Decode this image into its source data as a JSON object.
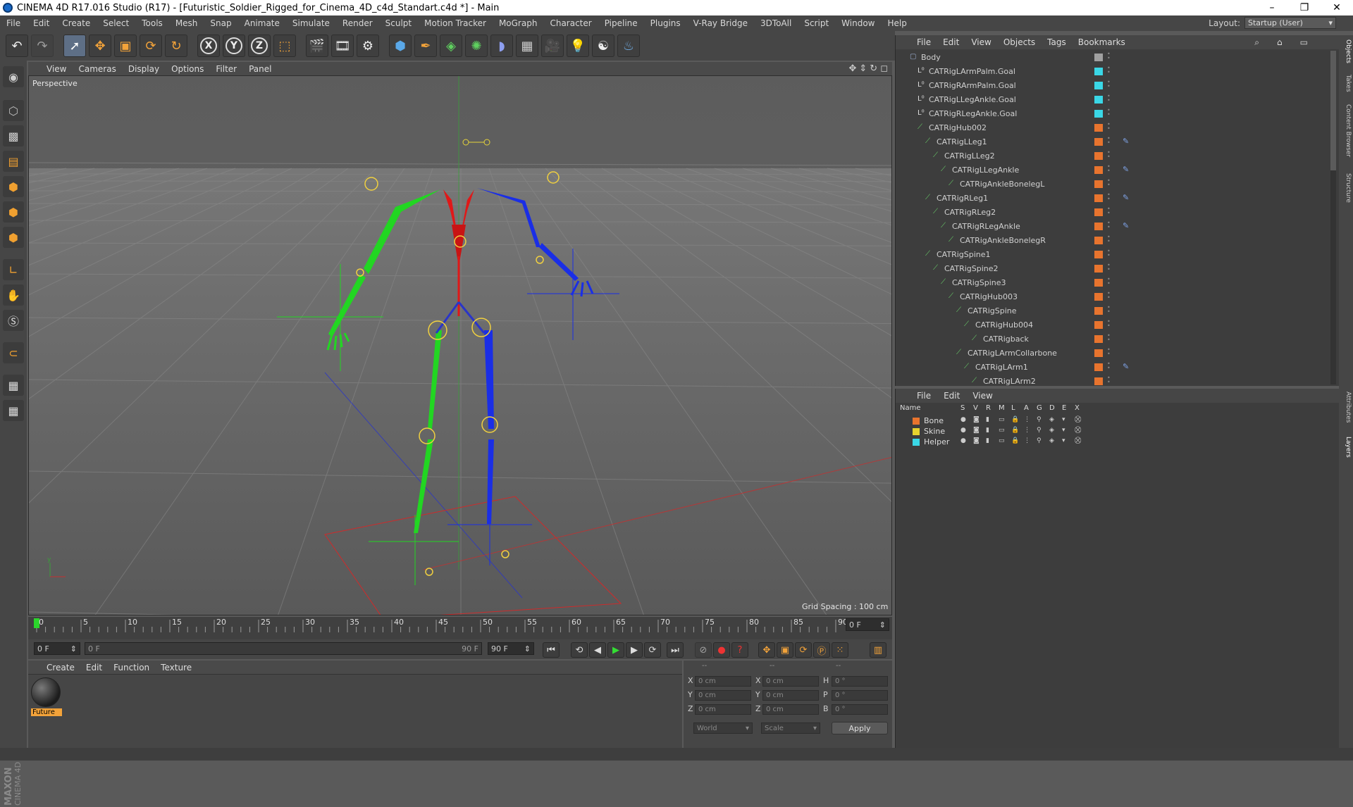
{
  "window": {
    "title": "CINEMA 4D R17.016 Studio (R17) - [Futuristic_Soldier_Rigged_for_Cinema_4D_c4d_Standart.c4d *] - Main",
    "controls": [
      "–",
      "❐",
      "✕"
    ]
  },
  "menubar": {
    "items": [
      "File",
      "Edit",
      "Create",
      "Select",
      "Tools",
      "Mesh",
      "Snap",
      "Animate",
      "Simulate",
      "Render",
      "Sculpt",
      "Motion Tracker",
      "MoGraph",
      "Character",
      "Pipeline",
      "Plugins",
      "V-Ray Bridge",
      "3DToAll",
      "Script",
      "Window",
      "Help"
    ],
    "layout_label": "Layout:",
    "layout_value": "Startup (User)"
  },
  "toolbar": {
    "buttons": [
      "undo-icon",
      "redo-icon",
      "select-icon",
      "move-icon",
      "scale-icon",
      "rotate-icon",
      "recent-tool-icon",
      "x-axis-icon",
      "y-axis-icon",
      "z-axis-icon",
      "coord-system-icon",
      "render-view-icon",
      "render-picture-viewer-icon",
      "edit-render-settings-icon",
      "cube-icon",
      "pen-icon",
      "subdivision-icon",
      "array-icon",
      "deformer-icon",
      "floor-icon",
      "camera-icon",
      "light-icon",
      "cat-icon",
      "python-icon"
    ],
    "axis_labels": [
      "X",
      "Y",
      "Z"
    ]
  },
  "viewport": {
    "menu": [
      "View",
      "Cameras",
      "Display",
      "Options",
      "Filter",
      "Panel"
    ],
    "label": "Perspective",
    "grid_spacing": "Grid Spacing : 100 cm"
  },
  "timeline": {
    "ticks": [
      "0",
      "5",
      "10",
      "15",
      "20",
      "25",
      "30",
      "35",
      "40",
      "45",
      "50",
      "55",
      "60",
      "65",
      "70",
      "75",
      "80",
      "85",
      "90"
    ],
    "current_frame": "0 F",
    "start_field": "0 F",
    "range_start": "0 F",
    "range_end": "90 F",
    "end_field": "90 F"
  },
  "material_manager": {
    "menu": [
      "Create",
      "Edit",
      "Function",
      "Texture"
    ],
    "materials": [
      {
        "name": "Future"
      }
    ]
  },
  "coordinates": {
    "header": [
      "--",
      "--",
      "--"
    ],
    "rows": [
      {
        "a_label": "X",
        "a_val": "0 cm",
        "b_label": "X",
        "b_val": "0 cm",
        "c_label": "H",
        "c_val": "0 °"
      },
      {
        "a_label": "Y",
        "a_val": "0 cm",
        "b_label": "Y",
        "b_val": "0 cm",
        "c_label": "P",
        "c_val": "0 °"
      },
      {
        "a_label": "Z",
        "a_val": "0 cm",
        "b_label": "Z",
        "b_val": "0 cm",
        "c_label": "B",
        "c_val": "0 °"
      }
    ],
    "mode_select": "World",
    "scale_select": "Scale",
    "apply_label": "Apply"
  },
  "object_manager": {
    "menu": [
      "File",
      "Edit",
      "View",
      "Objects",
      "Tags",
      "Bookmarks"
    ],
    "objects": [
      {
        "name": "Body",
        "depth": 0,
        "icon": "null",
        "tag": "#a0a0a0",
        "cat": false
      },
      {
        "name": "CATRigLArmPalm.Goal",
        "depth": 1,
        "icon": "goal",
        "tag": "#3ad7e6",
        "cat": false
      },
      {
        "name": "CATRigRArmPalm.Goal",
        "depth": 1,
        "icon": "goal",
        "tag": "#3ad7e6",
        "cat": false
      },
      {
        "name": "CATRigLLegAnkle.Goal",
        "depth": 1,
        "icon": "goal",
        "tag": "#3ad7e6",
        "cat": false
      },
      {
        "name": "CATRigRLegAnkle.Goal",
        "depth": 1,
        "icon": "goal",
        "tag": "#3ad7e6",
        "cat": false
      },
      {
        "name": "CATRigHub002",
        "depth": 1,
        "icon": "bone",
        "tag": "#e8742e",
        "cat": false
      },
      {
        "name": "CATRigLLeg1",
        "depth": 2,
        "icon": "bone",
        "tag": "#e8742e",
        "cat": true
      },
      {
        "name": "CATRigLLeg2",
        "depth": 3,
        "icon": "bone",
        "tag": "#e8742e",
        "cat": false
      },
      {
        "name": "CATRigLLegAnkle",
        "depth": 4,
        "icon": "bone",
        "tag": "#e8742e",
        "cat": true
      },
      {
        "name": "CATRigAnkleBonelegL",
        "depth": 5,
        "icon": "bone",
        "tag": "#e8742e",
        "cat": false
      },
      {
        "name": "CATRigRLeg1",
        "depth": 2,
        "icon": "bone",
        "tag": "#e8742e",
        "cat": true
      },
      {
        "name": "CATRigRLeg2",
        "depth": 3,
        "icon": "bone",
        "tag": "#e8742e",
        "cat": false
      },
      {
        "name": "CATRigRLegAnkle",
        "depth": 4,
        "icon": "bone",
        "tag": "#e8742e",
        "cat": true
      },
      {
        "name": "CATRigAnkleBonelegR",
        "depth": 5,
        "icon": "bone",
        "tag": "#e8742e",
        "cat": false
      },
      {
        "name": "CATRigSpine1",
        "depth": 2,
        "icon": "bone",
        "tag": "#e8742e",
        "cat": false
      },
      {
        "name": "CATRigSpine2",
        "depth": 3,
        "icon": "bone",
        "tag": "#e8742e",
        "cat": false
      },
      {
        "name": "CATRigSpine3",
        "depth": 4,
        "icon": "bone",
        "tag": "#e8742e",
        "cat": false
      },
      {
        "name": "CATRigHub003",
        "depth": 5,
        "icon": "bone",
        "tag": "#e8742e",
        "cat": false
      },
      {
        "name": "CATRigSpine",
        "depth": 6,
        "icon": "bone",
        "tag": "#e8742e",
        "cat": false
      },
      {
        "name": "CATRigHub004",
        "depth": 7,
        "icon": "bone",
        "tag": "#e8742e",
        "cat": false
      },
      {
        "name": "CATRigback",
        "depth": 8,
        "icon": "bone",
        "tag": "#e8742e",
        "cat": false
      },
      {
        "name": "CATRigLArmCollarbone",
        "depth": 6,
        "icon": "bone",
        "tag": "#e8742e",
        "cat": false
      },
      {
        "name": "CATRigLArm1",
        "depth": 7,
        "icon": "bone",
        "tag": "#e8742e",
        "cat": true
      },
      {
        "name": "CATRigLArm2",
        "depth": 8,
        "icon": "bone",
        "tag": "#e8742e",
        "cat": false
      }
    ]
  },
  "layer_manager": {
    "menu": [
      "File",
      "Edit",
      "View"
    ],
    "columns": [
      "Name",
      "S",
      "V",
      "R",
      "M",
      "L",
      "A",
      "G",
      "D",
      "E",
      "X"
    ],
    "layers": [
      {
        "name": "Bone",
        "color": "#e8742e"
      },
      {
        "name": "Skine",
        "color": "#e6d22e"
      },
      {
        "name": "Helper",
        "color": "#3ad7e6"
      }
    ]
  },
  "right_tabs": [
    "Objects",
    "Takes",
    "Content Browser",
    "Structure",
    "Attributes",
    "Layers"
  ],
  "brand": {
    "line1": "MAXON",
    "line2": "CINEMA 4D"
  }
}
